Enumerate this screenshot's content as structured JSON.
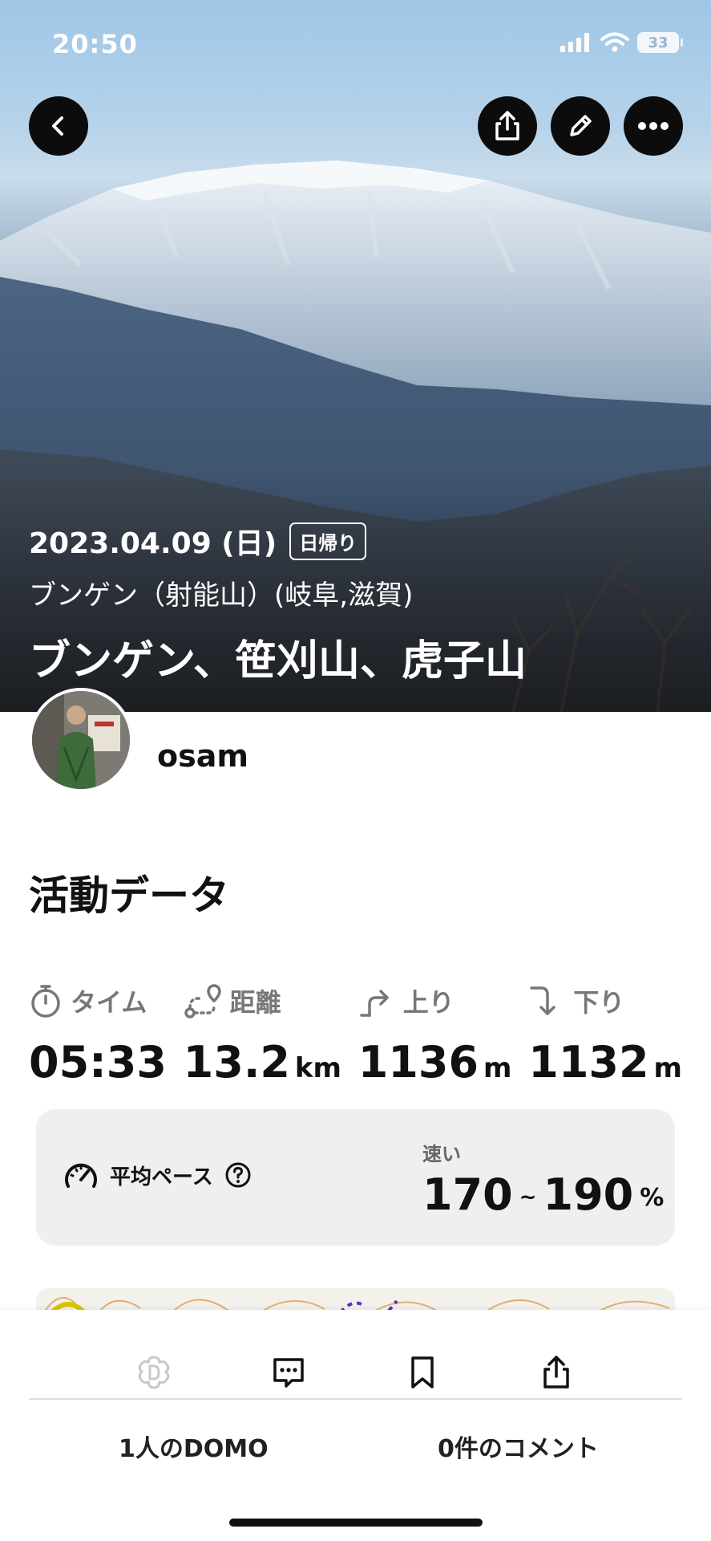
{
  "status_bar": {
    "time": "20:50",
    "battery": "33"
  },
  "header_actions": {
    "back": "back-icon",
    "share": "share-icon",
    "edit": "pencil-icon",
    "more": "more-icon"
  },
  "hero": {
    "date": "2023.04.09 (日)",
    "badge": "日帰り",
    "area": "ブンゲン（射能山）(岐阜,滋賀)",
    "title": "ブンゲン、笹刈山、虎子山"
  },
  "user": {
    "name": "osam"
  },
  "activity": {
    "section_title": "活動データ",
    "stats": [
      {
        "label": "タイム",
        "value": "05:33",
        "unit": "",
        "icon": "stopwatch-icon"
      },
      {
        "label": "距離",
        "value": "13.2",
        "unit": "km",
        "icon": "route-icon"
      },
      {
        "label": "上り",
        "value": "1136",
        "unit": "m",
        "icon": "ascent-icon"
      },
      {
        "label": "下り",
        "value": "1132",
        "unit": "m",
        "icon": "descent-icon"
      }
    ],
    "pace": {
      "label": "平均ペース",
      "speed_label": "速い",
      "min": "170",
      "separator": "~",
      "max": "190",
      "unit": "%"
    }
  },
  "bottom_bar": {
    "domo_label": "1人のDOMO",
    "comment_label": "0件のコメント"
  },
  "colors": {
    "accent_dark": "#0c0c0c",
    "card_bg": "#efefef",
    "muted_text": "#777777"
  }
}
